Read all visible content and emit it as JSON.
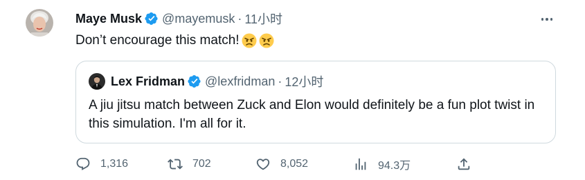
{
  "tweet": {
    "author_name": "Maye Musk",
    "author_handle": "@mayemusk",
    "separator": "·",
    "time": "11小时",
    "text": "Don’t encourage this match!",
    "emojis": [
      "angry-face",
      "angry-face"
    ]
  },
  "quoted_tweet": {
    "author_name": "Lex Fridman",
    "author_handle": "@lexfridman",
    "separator": "·",
    "time": "12小时",
    "text": "A jiu jitsu match between Zuck and Elon would definitely be a fun plot twist in this simulation. I'm all for it."
  },
  "actions": {
    "replies": "1,316",
    "retweets": "702",
    "likes": "8,052",
    "views": "94.3万"
  },
  "colors": {
    "text_primary": "#0f1419",
    "text_secondary": "#536471",
    "verified_badge": "#1d9bf0",
    "border": "#cfd9de"
  },
  "icons": [
    "verified-badge-icon",
    "more-options-icon",
    "reply-icon",
    "retweet-icon",
    "like-icon",
    "views-icon",
    "share-icon"
  ]
}
